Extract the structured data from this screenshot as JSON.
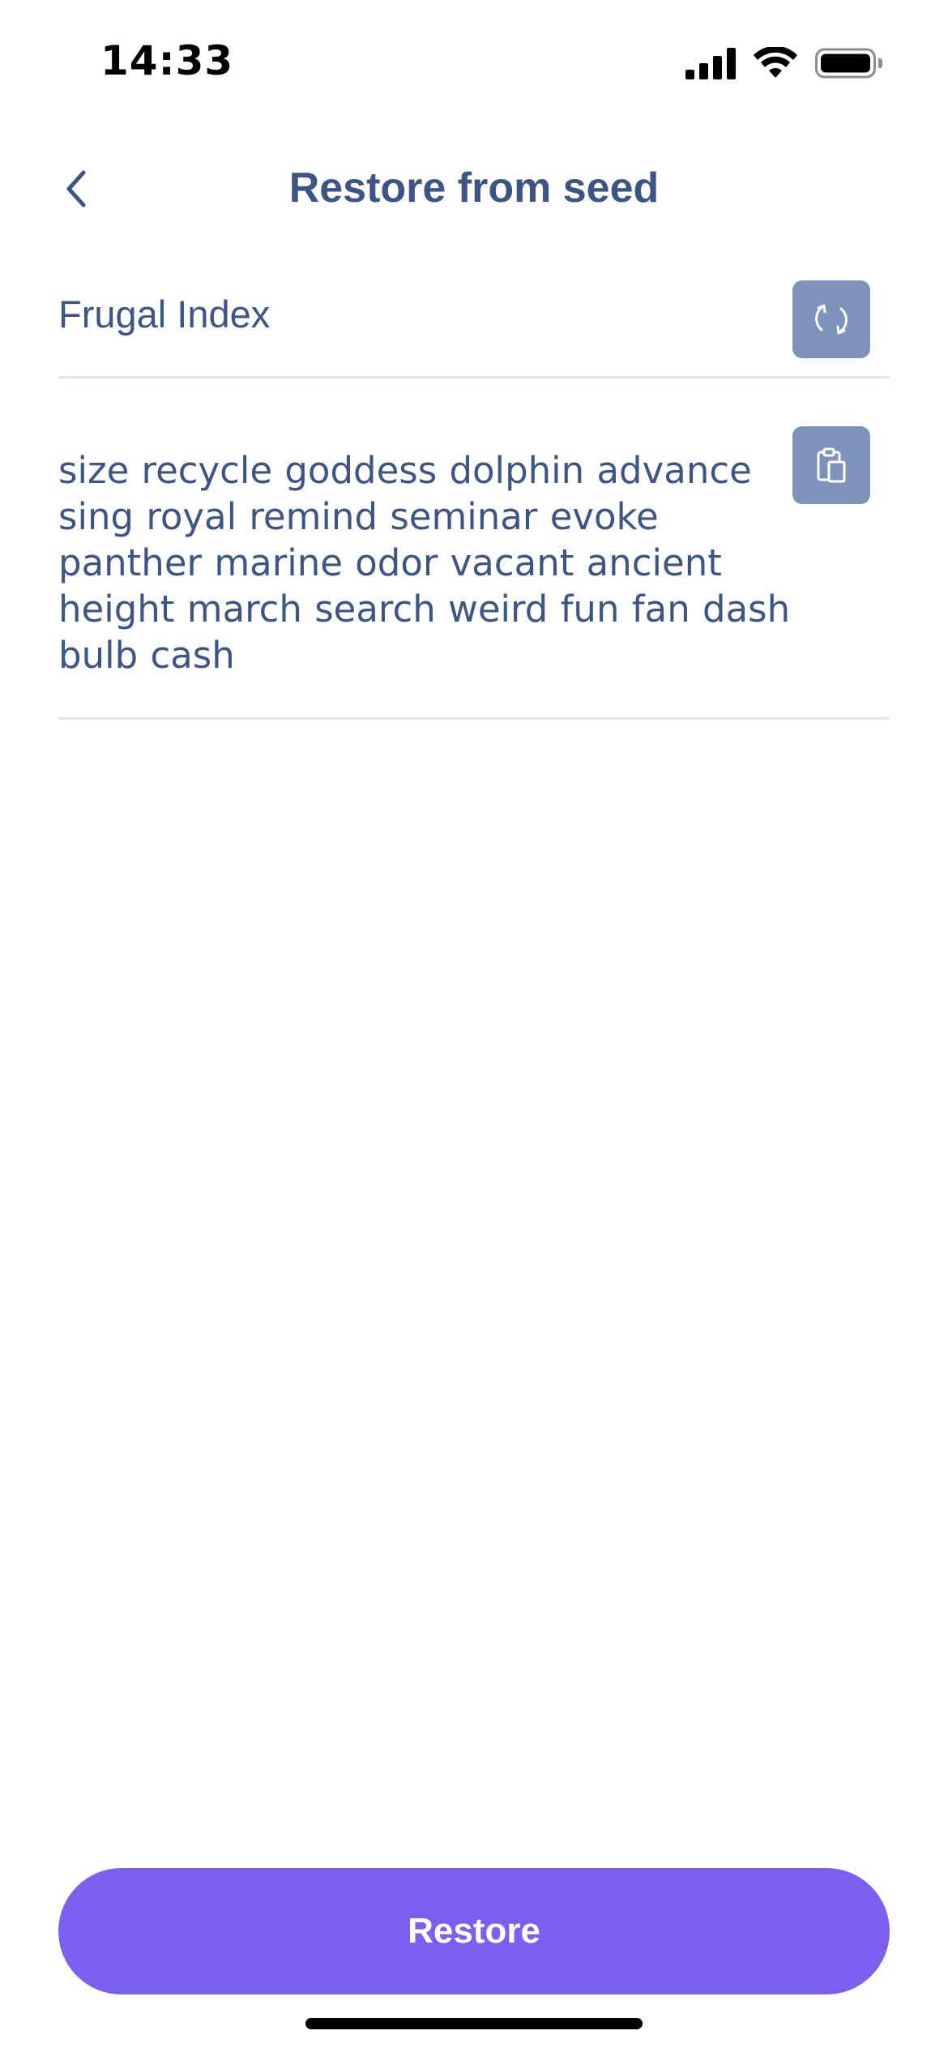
{
  "status_bar": {
    "time": "14:33",
    "icons": [
      "cellular-signal-icon",
      "wifi-icon",
      "battery-icon"
    ]
  },
  "header": {
    "title": "Restore from seed",
    "back_icon": "chevron-left-icon"
  },
  "wallet_name": {
    "value": "Frugal Index",
    "action_icon": "refresh-icon"
  },
  "seed_phrase": {
    "value": "size recycle goddess dolphin advance sing royal remind seminar evoke panther marine odor vacant ancient height march search weird fun fan dash bulb cash",
    "action_icon": "clipboard-icon"
  },
  "footer": {
    "restore_label": "Restore"
  },
  "colors": {
    "text_primary": "#3D5585",
    "icon_button_bg": "#7D93BA",
    "accent": "#7B60F0",
    "divider": "#E3E5F1"
  }
}
